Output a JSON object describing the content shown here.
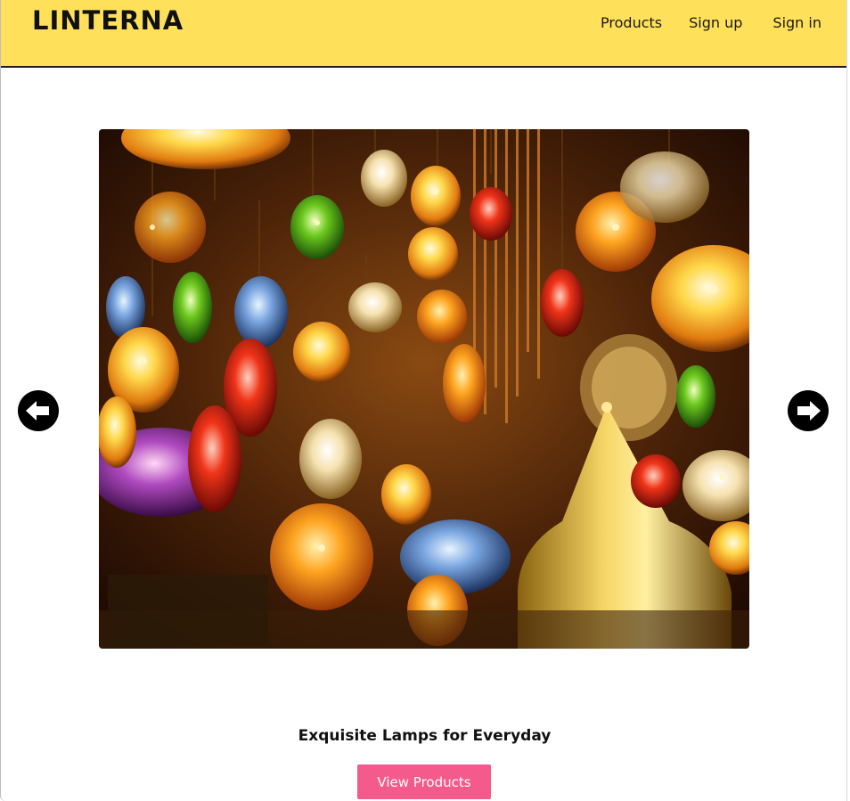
{
  "header": {
    "brand": "LINTERNA",
    "nav": [
      {
        "label": "Products"
      },
      {
        "label": "Sign up"
      },
      {
        "label": "Sign in"
      }
    ],
    "background_color": "#ffe05a"
  },
  "carousel": {
    "image_alt": "Colorful mosaic lamps hanging in a bazaar",
    "prev_icon": "arrow-left-circle-icon",
    "next_icon": "arrow-right-circle-icon"
  },
  "hero": {
    "tagline": "Exquisite Lamps for Everyday",
    "cta_label": "View Products",
    "cta_color": "#f45a8c"
  }
}
